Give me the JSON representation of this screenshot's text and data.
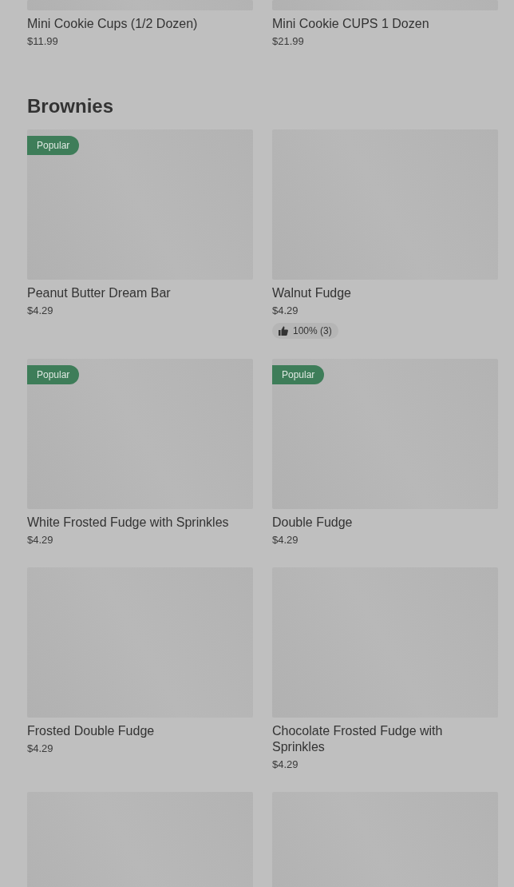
{
  "previous_items": [
    {
      "kind": "product",
      "name": "Mini Cookie Cups (1/2 Dozen)",
      "price": "$11.99"
    },
    {
      "kind": "product",
      "name": "Mini Cookie CUPS 1 Dozen",
      "price": "$21.99"
    }
  ],
  "section": {
    "title": "Brownies",
    "items": [
      {
        "kind": "product",
        "name": "Peanut Butter Dream Bar",
        "price": "$4.29",
        "badge": "Popular"
      },
      {
        "kind": "product",
        "name": "Walnut Fudge",
        "price": "$4.29",
        "rating": "100% (3)"
      },
      {
        "kind": "product",
        "name": "White Frosted Fudge with Sprinkles",
        "price": "$4.29",
        "badge": "Popular"
      },
      {
        "kind": "product",
        "name": "Double Fudge",
        "price": "$4.29",
        "badge": "Popular"
      },
      {
        "kind": "product",
        "name": "Frosted Double Fudge",
        "price": "$4.29"
      },
      {
        "kind": "product",
        "name": "Chocolate Frosted Fudge with Sprinkles",
        "price": "$4.29"
      },
      {
        "kind": "picture"
      },
      {
        "kind": "picture"
      }
    ]
  }
}
